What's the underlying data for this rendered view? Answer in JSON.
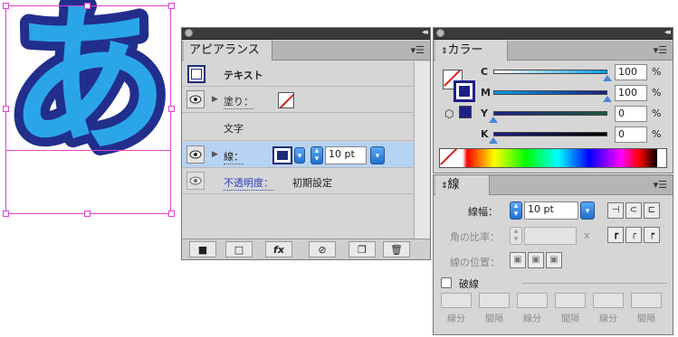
{
  "artboard": {
    "glyph": "あ",
    "colors": {
      "fill": "#2aa6e8",
      "stroke": "#222e8c",
      "selection": "#e040d0"
    }
  },
  "appearance_panel": {
    "title": "アピアランス",
    "object_label": "テキスト",
    "fill_label": "塗り：",
    "character_label": "文字",
    "stroke_label": "線：",
    "stroke_weight": "10 pt",
    "opacity_label": "不透明度：",
    "opacity_value": "初期設定",
    "bottom_icons": [
      "new-art-icon",
      "clear-icon",
      "fx-icon",
      "no-icon",
      "duplicate-icon",
      "trash-icon"
    ]
  },
  "color_panel": {
    "title": "カラー",
    "channels": [
      {
        "label": "C",
        "value": "100",
        "fraction": 1.0,
        "gradient": "#ffffff,#00a0e9"
      },
      {
        "label": "M",
        "value": "100",
        "fraction": 1.0,
        "gradient": "#00a0e9,#1d2088"
      },
      {
        "label": "Y",
        "value": "0",
        "fraction": 0.0,
        "gradient": "#1d2088,#1d5a3a"
      },
      {
        "label": "K",
        "value": "0",
        "fraction": 0.0,
        "gradient": "#1d2088,#000000"
      }
    ],
    "unit": "%"
  },
  "stroke_panel": {
    "title": "線",
    "weight_label": "線幅：",
    "weight_value": "10 pt",
    "miter_label": "角の比率：",
    "miter_unit": "x",
    "align_label": "線の位置：",
    "dashed_label": "破線",
    "dash_labels": [
      "線分",
      "間隔",
      "線分",
      "間隔",
      "線分",
      "間隔"
    ]
  }
}
